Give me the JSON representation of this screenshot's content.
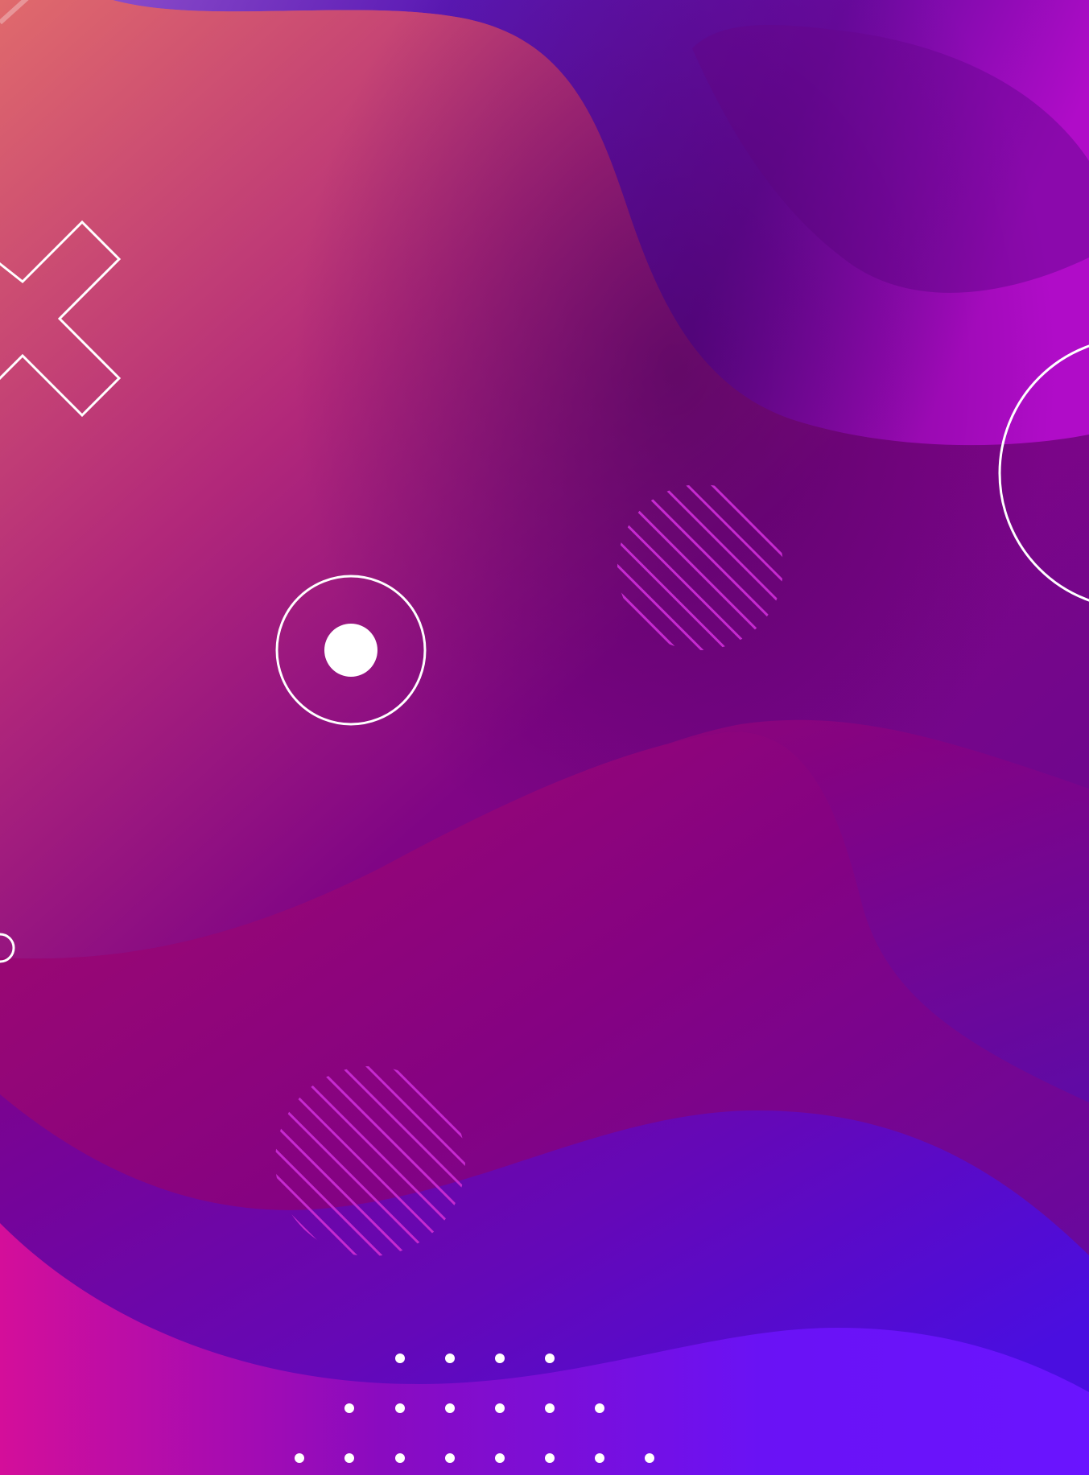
{
  "artwork": {
    "type": "abstract-fluid-background",
    "text": "",
    "colors": {
      "coral": "#e0696b",
      "rose": "#c23e74",
      "magenta": "#b0157e",
      "plum": "#7e0a86",
      "deep_plum": "#5c046f",
      "violet": "#5c0aa6",
      "indigo": "#4e0cd8",
      "electric_violet": "#6a12ff",
      "hot_pink": "#d01097",
      "line": "#ffffff",
      "hatch": "#c62ad0"
    },
    "decorations": [
      "cross-outline",
      "target-ring",
      "large-ring",
      "small-ring",
      "hatched-circle",
      "hatched-circle",
      "dot-grid"
    ]
  }
}
